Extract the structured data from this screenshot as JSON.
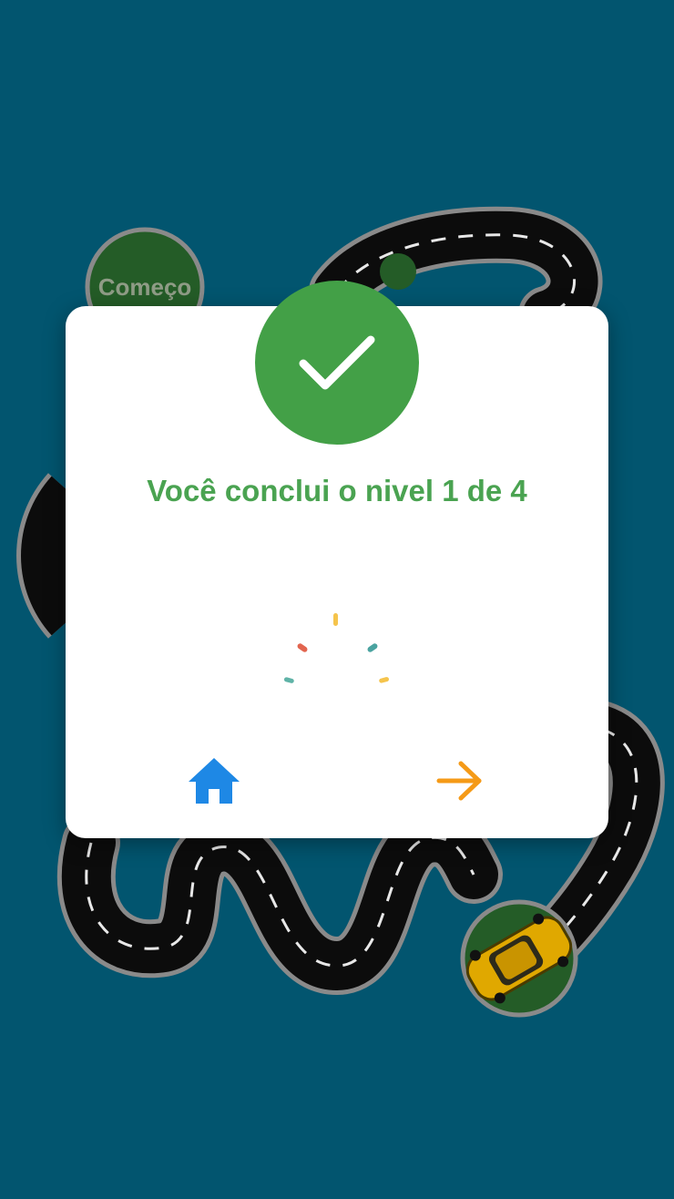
{
  "game": {
    "start_label": "Começo",
    "background_color": "#02556f",
    "start_marker_icon": "start-circle",
    "finish_marker_icon": "finish-circle",
    "vehicle_icon": "taxi-car-icon"
  },
  "dialog": {
    "status_icon": "checkmark-icon",
    "status_color": "#43a047",
    "message": "Você conclui o nivel 1 de 4",
    "message_color": "#4aa351",
    "home_icon": "home-icon",
    "home_color": "#1e88e5",
    "next_icon": "arrow-right-icon",
    "next_color": "#f59a17"
  }
}
